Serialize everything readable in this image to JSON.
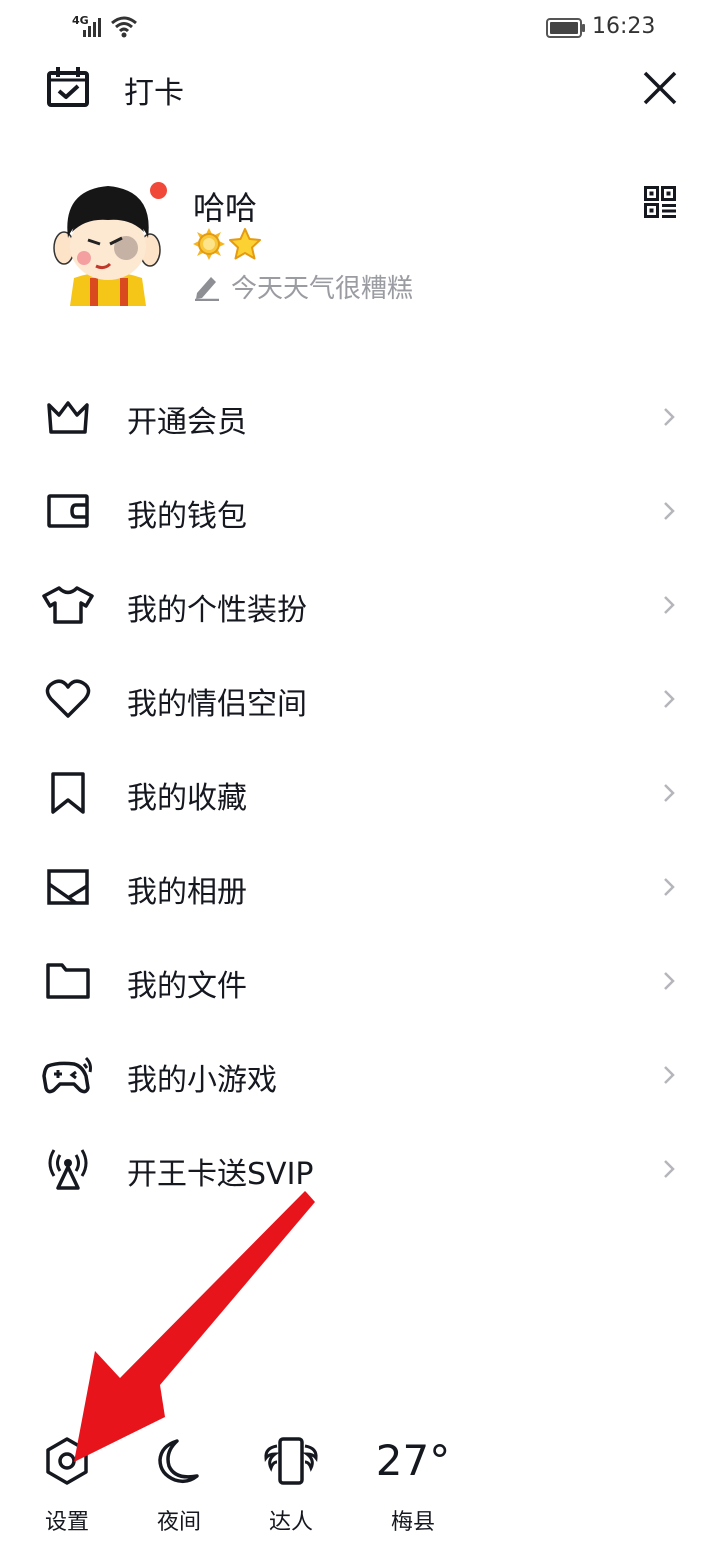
{
  "status_bar": {
    "network": "4G",
    "time": "16:23"
  },
  "header": {
    "checkin_label": "打卡"
  },
  "profile": {
    "name": "哈哈",
    "signature": "今天天气很糟糕"
  },
  "menu": [
    {
      "label": "开通会员",
      "icon": "crown-icon"
    },
    {
      "label": "我的钱包",
      "icon": "wallet-icon"
    },
    {
      "label": "我的个性装扮",
      "icon": "tshirt-icon"
    },
    {
      "label": "我的情侣空间",
      "icon": "heart-icon"
    },
    {
      "label": "我的收藏",
      "icon": "bookmark-icon"
    },
    {
      "label": "我的相册",
      "icon": "photo-icon"
    },
    {
      "label": "我的文件",
      "icon": "folder-icon"
    },
    {
      "label": "我的小游戏",
      "icon": "gamepad-icon"
    },
    {
      "label": "开王卡送SVIP",
      "icon": "signal-tower-icon"
    }
  ],
  "bottom": {
    "settings": "设置",
    "night": "夜间",
    "expert": "达人",
    "temperature": "27°",
    "city": "梅县"
  },
  "colors": {
    "accent_red": "#e8141c",
    "dot_red": "#f0493a",
    "text": "#161820"
  }
}
